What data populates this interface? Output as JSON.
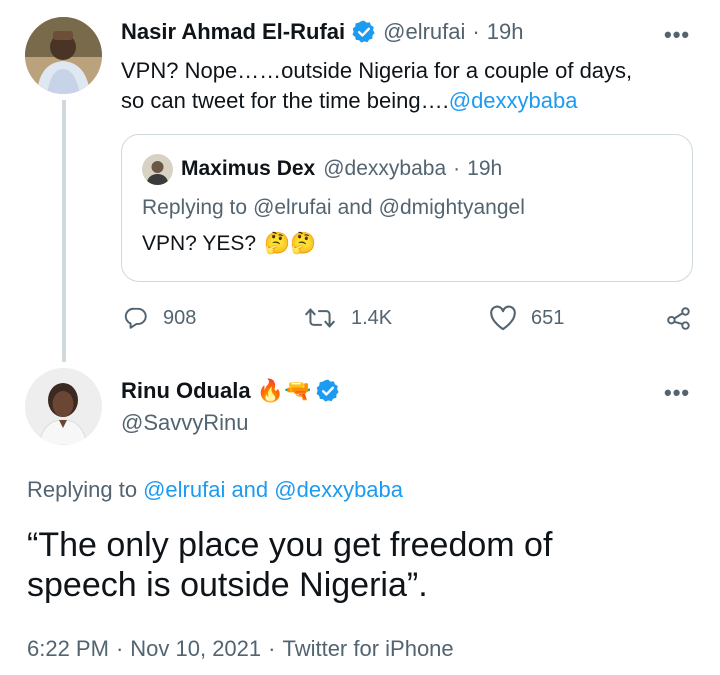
{
  "parent_tweet": {
    "author_name": "Nasir Ahmad El-Rufai",
    "handle": "@elrufai",
    "separator": "·",
    "time_ago": "19h",
    "text_line1": "VPN? Nope……outside Nigeria for a couple of days,",
    "text_line2": "so can tweet for the time being….",
    "mention": "@dexxybaba",
    "more": "•••"
  },
  "quoted_tweet": {
    "author_name": "Maximus Dex",
    "handle": "@dexxybaba",
    "separator": "·",
    "time_ago": "19h",
    "replying_prefix": "Replying to",
    "reply_mention1": "@elrufai",
    "reply_and": "and",
    "reply_mention2": "@dmightyangel",
    "text": "VPN? YES?",
    "emoji": "🤔🤔"
  },
  "actions": {
    "replies": "908",
    "retweets": "1.4K",
    "likes": "651"
  },
  "main_tweet": {
    "author_name": "Rinu Oduala",
    "name_emoji": "🔥🔫",
    "handle": "@SavvyRinu",
    "more": "•••",
    "replying_prefix": "Replying to",
    "reply_mentions": "@elrufai and @dexxybaba",
    "text_line1": "“The only place you get freedom of",
    "text_line2": "speech is outside Nigeria”.",
    "time": "6:22 PM",
    "separator": "·",
    "date": "Nov 10, 2021",
    "source": "Twitter for iPhone"
  },
  "colors": {
    "link": "#1d9bf0",
    "muted": "#536471",
    "text": "#0f1419",
    "border": "#cfd9de"
  }
}
